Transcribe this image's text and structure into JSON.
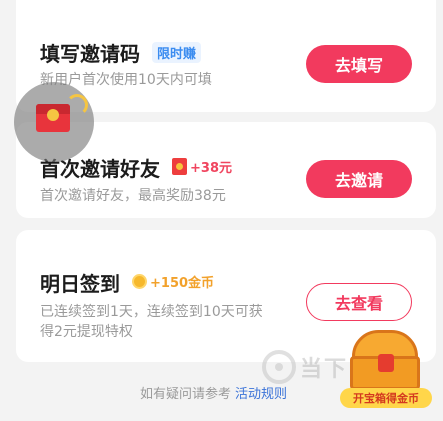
{
  "cards": [
    {
      "title": "填写邀请码",
      "badge": "限时赚",
      "subtitle": "新用户首次使用10天内可填",
      "button": "去填写"
    },
    {
      "title": "首次邀请好友",
      "reward": "+38元",
      "subtitle": "首次邀请好友，最高奖励38元",
      "button": "去邀请"
    },
    {
      "title": "明日签到",
      "reward": "+150金币",
      "subtitle_line1": "已连续签到1天，连续签到10天可获",
      "subtitle_line2": "得2元提现特权",
      "button": "去查看"
    }
  ],
  "footer": {
    "text": "如有疑问请参考",
    "link": "活动规则"
  },
  "treasure": {
    "label": "开宝箱得金币"
  },
  "watermark": {
    "text": "当下"
  },
  "colors": {
    "accent": "#f23a5e",
    "badge_blue": "#3b8cf0",
    "gold": "#f2a12b",
    "background": "#f3f3f3"
  },
  "icons": [
    "redpacket-icon",
    "coin-icon",
    "treasure-chest-icon",
    "floating-redpacket-icon"
  ]
}
